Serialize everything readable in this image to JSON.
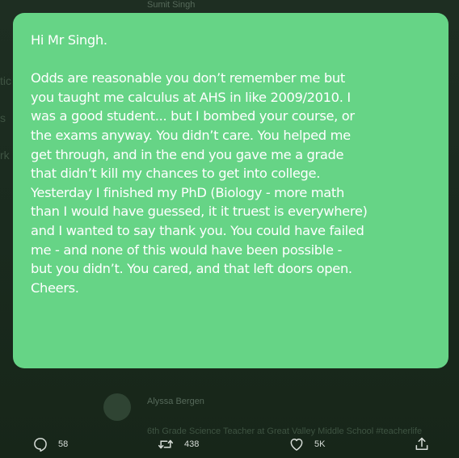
{
  "background": {
    "top_author": "Sumit Singh",
    "side_fragments": [
      "tic",
      "s",
      "rk"
    ],
    "bottom_author": "Alyssa Bergen",
    "bottom_bio": "6th Grade Science Teacher at Great Valley Middle School #teacherlife"
  },
  "note": {
    "background_color": "#66d486",
    "text_color": "#ffffff",
    "greeting": "Hi Mr Singh.",
    "body": "Odds are reasonable you don’t remember me but\nyou taught me calculus at AHS in like 2009/2010. I\nwas a good student... but I bombed your course, or\nthe exams anyway. You didn’t care. You helped me\nget through, and in the end you gave me a grade\nthat didn’t kill my chances to get into college.\nYesterday I finished my PhD (Biology - more math\nthan I would have guessed,  it it truest is everywhere)\nand I wanted to say thank you. You could have failed\nme - and none of this would have been possible -\nbut you didn’t. You cared, and that left doors open.\nCheers."
  },
  "actions": {
    "reply": {
      "icon": "reply-icon",
      "count": "58"
    },
    "retweet": {
      "icon": "retweet-icon",
      "count": "438"
    },
    "like": {
      "icon": "heart-icon",
      "count": "5K"
    },
    "share": {
      "icon": "share-icon"
    }
  }
}
